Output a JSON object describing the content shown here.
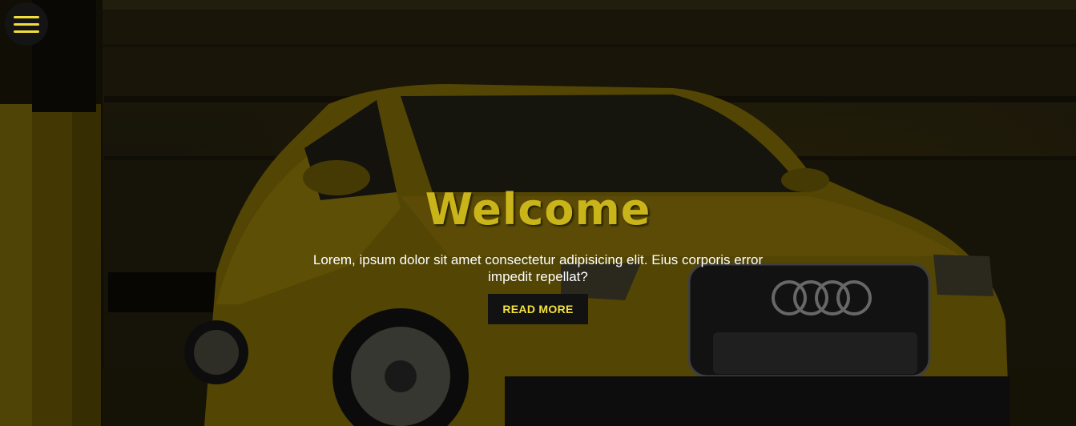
{
  "hero": {
    "title": "Welcome",
    "description": "Lorem, ipsum dolor sit amet consectetur adipisicing elit. Eius corporis error impedit repellat?",
    "cta_label": "READ MORE"
  },
  "nav": {
    "menu_icon": "hamburger-menu-icon"
  },
  "colors": {
    "accent": "#f5e13b",
    "title": "#c9b41a",
    "button_bg": "#121212",
    "overlay": "#000000"
  },
  "background": {
    "subject": "yellow-sports-sedan-in-parking-garage"
  }
}
